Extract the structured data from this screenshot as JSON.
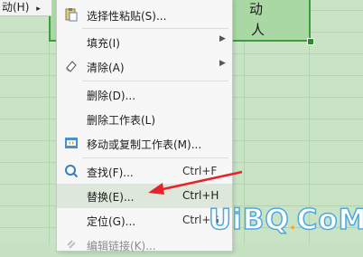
{
  "left_menu": {
    "label": "动(H)",
    "arrow": "▸"
  },
  "cells": {
    "top": "动",
    "bottom": "人"
  },
  "menu": {
    "items": [
      {
        "name": "paste-special",
        "label": "选择性粘贴(S)...",
        "shortcut": "",
        "submenu": false,
        "icon": "paste-icon"
      },
      {
        "name": "fill",
        "label": "填充(I)",
        "shortcut": "",
        "submenu": true,
        "icon": ""
      },
      {
        "name": "clear",
        "label": "清除(A)",
        "shortcut": "",
        "submenu": true,
        "icon": "eraser-icon"
      },
      {
        "name": "delete",
        "label": "删除(D)...",
        "shortcut": "",
        "submenu": false,
        "icon": ""
      },
      {
        "name": "delete-sheet",
        "label": "删除工作表(L)",
        "shortcut": "",
        "submenu": false,
        "icon": ""
      },
      {
        "name": "move-copy-sheet",
        "label": "移动或复制工作表(M)...",
        "shortcut": "",
        "submenu": false,
        "icon": "move-sheet-icon"
      },
      {
        "name": "find",
        "label": "查找(F)...",
        "shortcut": "Ctrl+F",
        "submenu": false,
        "icon": "find-icon"
      },
      {
        "name": "replace",
        "label": "替换(E)...",
        "shortcut": "Ctrl+H",
        "submenu": false,
        "icon": ""
      },
      {
        "name": "goto",
        "label": "定位(G)...",
        "shortcut": "Ctrl+G",
        "submenu": false,
        "icon": ""
      },
      {
        "name": "edit-link",
        "label": "编辑链接(K)...",
        "shortcut": "",
        "submenu": false,
        "icon": "link-icon"
      }
    ],
    "highlighted": "replace"
  },
  "watermark": {
    "text_a": "UiBQ",
    "dot": ".",
    "text_b": "CoM"
  },
  "colors": {
    "accent": "#3c9d3c",
    "arrow": "#e8222a",
    "watermark": "#4aa8e6"
  }
}
